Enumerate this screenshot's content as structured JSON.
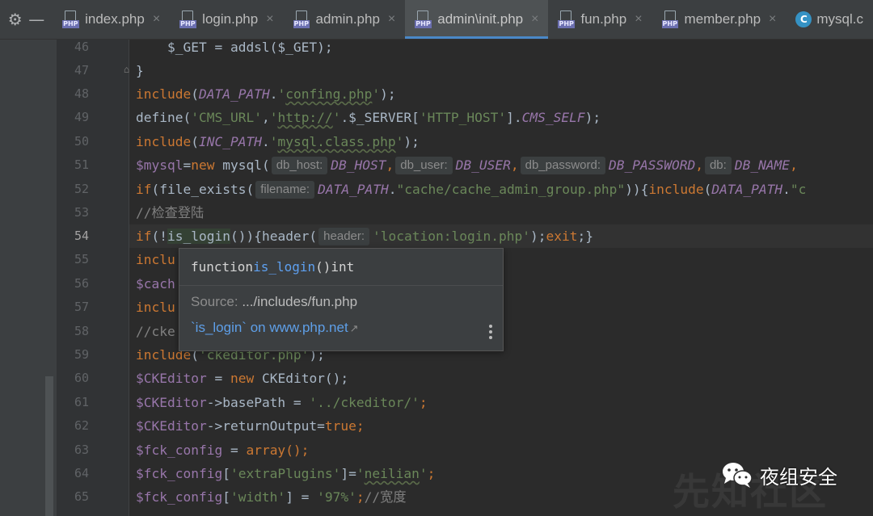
{
  "toolbar": {
    "settings_icon": "gear-icon",
    "collapse_icon": "minus-icon"
  },
  "tabs": [
    {
      "label": "index.php",
      "icon": "php-file-icon",
      "active": false,
      "closable": true
    },
    {
      "label": "login.php",
      "icon": "php-file-icon",
      "active": false,
      "closable": true
    },
    {
      "label": "admin.php",
      "icon": "php-file-icon",
      "active": false,
      "closable": true
    },
    {
      "label": "admin\\init.php",
      "icon": "php-file-icon",
      "active": true,
      "closable": true
    },
    {
      "label": "fun.php",
      "icon": "php-file-icon",
      "active": false,
      "closable": true
    },
    {
      "label": "member.php",
      "icon": "php-file-icon",
      "active": false,
      "closable": true
    },
    {
      "label": "mysql.c",
      "icon": "class-icon",
      "active": false,
      "closable": false
    }
  ],
  "tab_close_glyph": "×",
  "class_icon_letter": "C",
  "php_icon_label": "PHP",
  "editor": {
    "current_line": 54,
    "line_numbers": [
      "46",
      "47",
      "48",
      "49",
      "50",
      "51",
      "52",
      "53",
      "54",
      "55",
      "56",
      "57",
      "58",
      "59",
      "60",
      "61",
      "62",
      "63",
      "64",
      "65"
    ],
    "lines": {
      "l46": {
        "a": "    $_GET = addsl($_GET);"
      },
      "l47": {
        "a": "}"
      },
      "l48": {
        "a": "include",
        "b": "(",
        "c": "DATA_PATH",
        "d": ".",
        "e": "'",
        "f": "confing.php",
        "g": "'",
        "h": ");"
      },
      "l49": {
        "a": "define(",
        "b": "'CMS_URL'",
        "c": ",",
        "d": "'",
        "e": "http://",
        "f": "'",
        "g": ".$_SERVER[",
        "h": "'HTTP_HOST'",
        "i": "].",
        "j": "CMS_SELF",
        "k": ");"
      },
      "l50": {
        "a": "include",
        "b": "(",
        "c": "INC_PATH",
        "d": ".",
        "e": "'",
        "f": "mysql.class.php",
        "g": "'",
        "h": ");"
      },
      "l51": {
        "a": "$mysql",
        "b": "=",
        "c": "new",
        "d": " mysql(",
        "h1": "db_host:",
        "e": "DB_HOST",
        "f": ",",
        "h2": "db_user:",
        "g": "DB_USER",
        "i": ",",
        "h3": "db_password:",
        "j": "DB_PASSWORD",
        "k": ",",
        "h4": "db:",
        "l": "DB_NAME",
        "m": ","
      },
      "l52": {
        "a": "if",
        "b": "(file_exists(",
        "h1": "filename:",
        "c": "DATA_PATH",
        "d": ".",
        "e": "\"cache/cache_admin_group.php\"",
        "f": ")){",
        "g": "include",
        "i": "(",
        "j": "DATA_PATH",
        "k": ".",
        "l": "\"c"
      },
      "l53": {
        "a": "//检查登陆"
      },
      "l54": {
        "a": "if",
        "b": "(!",
        "c": "is_login",
        "d": "()){header(",
        "h1": "header:",
        "e": "'location:login.php'",
        "f": ");",
        "g": "exit",
        "h": ";}"
      },
      "l55": {
        "a": "inclu"
      },
      "l56": {
        "a": "$cach"
      },
      "l57": {
        "a": "inclu"
      },
      "l58": {
        "a": "//cke"
      },
      "l59": {
        "a": "include",
        "b": "(",
        "c": "'ckeditor.php'",
        "d": ");"
      },
      "l60": {
        "a": "$CKEditor",
        "b": " = ",
        "c": "new",
        "d": " CKEditor();"
      },
      "l61": {
        "a": "$CKEditor",
        "b": "->basePath = ",
        "c": "'../ckeditor/'",
        "d": ";"
      },
      "l62": {
        "a": "$CKEditor",
        "b": "->returnOutput=",
        "c": "true",
        "d": ";"
      },
      "l63": {
        "a": "$fck_config",
        "b": " = ",
        "c": "array",
        "d": "();"
      },
      "l64": {
        "a": "$fck_config",
        "b": "[",
        "c": "'extraPlugins'",
        "d": "]=",
        "e": "'",
        "f": "neilian",
        "g": "'",
        "h": ";"
      },
      "l65": {
        "a": "$fck_config",
        "b": "[",
        "c": "'width'",
        "d": "] = ",
        "e": "'97%'",
        "f": ";",
        "g": "//宽度"
      }
    }
  },
  "popup": {
    "keyword": "function",
    "name": "is_login",
    "params": "()",
    "return_type": "int",
    "source_label": "Source:",
    "source_path": ".../includes/fun.php",
    "link_text": "`is_login` on www.php.net",
    "link_icon": "external-link-icon",
    "external_glyph": "↗",
    "more_icon": "more-vertical-icon"
  },
  "watermark": {
    "text": "夜组安全",
    "background_text": "先知社区",
    "icon": "wechat-icon"
  },
  "colors": {
    "editor_bg": "#2b2b2b",
    "keyword": "#cc7832",
    "string": "#6a8759",
    "constant": "#9876aa",
    "link": "#5e9fe8",
    "active_tab_underline": "#4a88c7"
  }
}
